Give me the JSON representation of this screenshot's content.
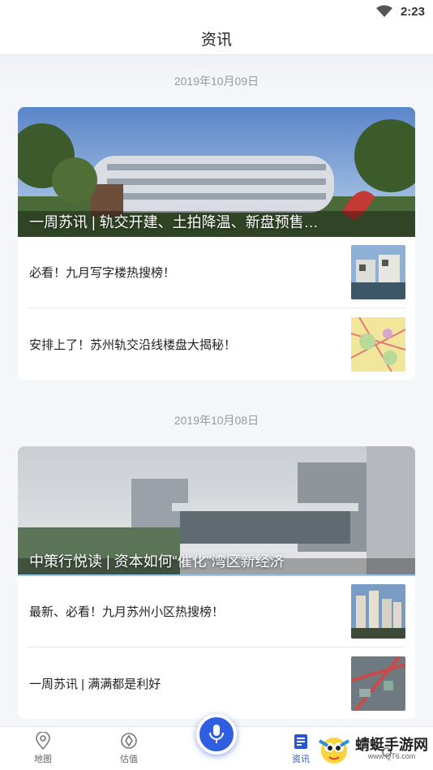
{
  "status_bar": {
    "time": "2:23"
  },
  "header": {
    "title": "资讯"
  },
  "feed": [
    {
      "date": "2019年10月09日",
      "headline": "一周苏讯 | 轨交开建、土拍降温、新盘预售…",
      "items": [
        {
          "title": "必看！九月写字楼热搜榜！"
        },
        {
          "title": "安排上了！苏州轨交沿线楼盘大揭秘！"
        }
      ]
    },
    {
      "date": "2019年10月08日",
      "headline": "中策行悦读 | 资本如何“催化”湾区新经济",
      "items": [
        {
          "title": "最新、必看！九月苏州小区热搜榜！"
        },
        {
          "title": "一周苏讯 | 满满都是利好"
        }
      ]
    }
  ],
  "tabbar": {
    "tabs": [
      {
        "label": "地图",
        "icon": "map-pin-icon"
      },
      {
        "label": "估值",
        "icon": "valuation-icon"
      },
      {
        "label": "",
        "icon": "microphone-icon"
      },
      {
        "label": "资讯",
        "icon": "news-icon"
      },
      {
        "label": "",
        "icon": "profile-icon"
      }
    ],
    "active_color": "#2b55d6"
  },
  "watermark": {
    "text": "蜻蜓手游网",
    "url": "www.QT6.com"
  }
}
